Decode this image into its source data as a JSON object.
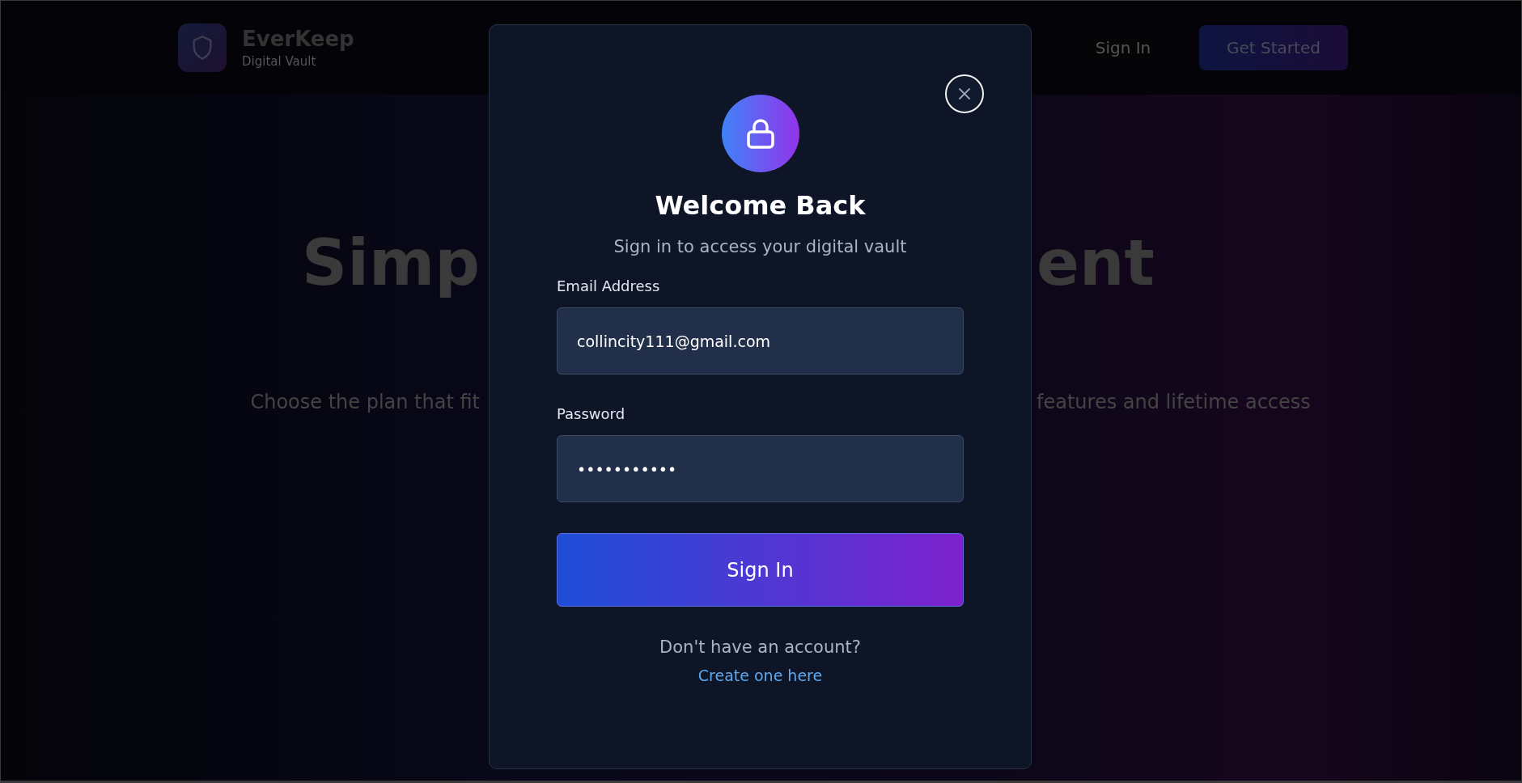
{
  "header": {
    "brand": "EverKeep",
    "tagline": "Digital Vault",
    "sign_in": "Sign In",
    "get_started": "Get Started"
  },
  "hero": {
    "title_left": "Simp",
    "title_right": "ent",
    "subtitle_left": "Choose the plan that fit",
    "subtitle_right": "features and lifetime access"
  },
  "modal": {
    "title": "Welcome Back",
    "subtitle": "Sign in to access your digital vault",
    "fields": [
      {
        "label": "Email Address",
        "value": "collincity111@gmail.com"
      },
      {
        "label": "Password",
        "value": "•••••••••••"
      }
    ],
    "submit": "Sign In",
    "prompt": "Don't have an account?",
    "link": "Create one here"
  }
}
